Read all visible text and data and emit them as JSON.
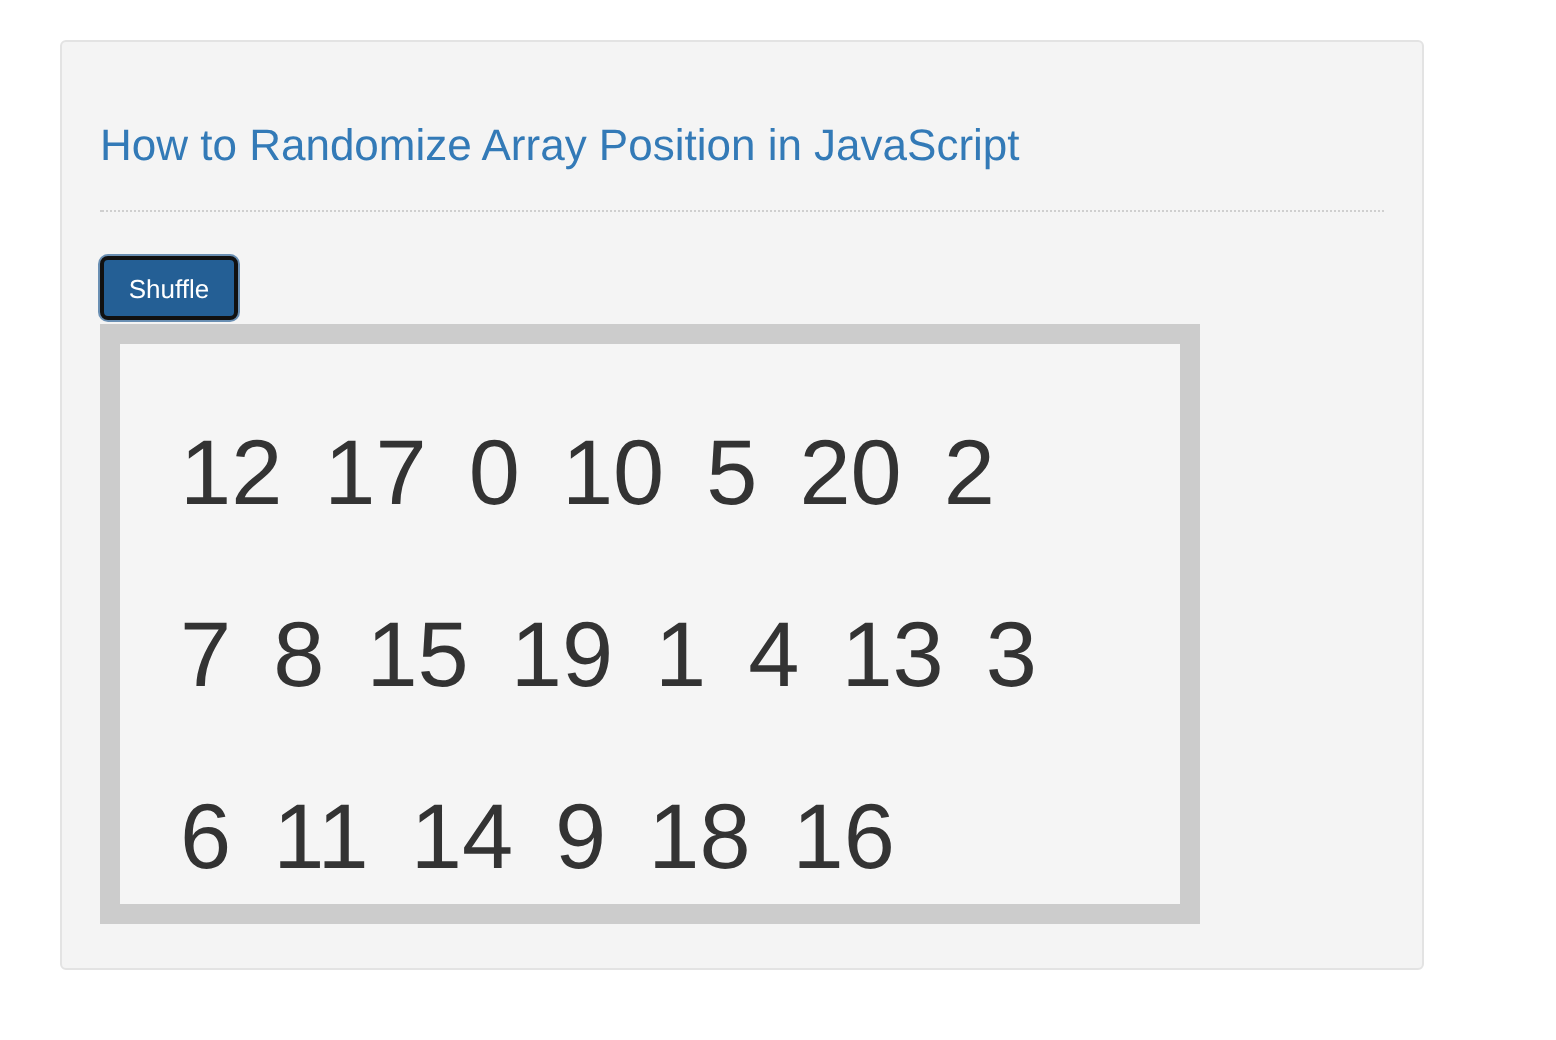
{
  "title": "How to Randomize Array Position in JavaScript",
  "button": {
    "label": "Shuffle"
  },
  "rows": [
    [
      "12",
      "17",
      "0",
      "10",
      "5",
      "20",
      "2"
    ],
    [
      "7",
      "8",
      "15",
      "19",
      "1",
      "4",
      "13",
      "3"
    ],
    [
      "6",
      "11",
      "14",
      "9",
      "18",
      "16"
    ]
  ]
}
